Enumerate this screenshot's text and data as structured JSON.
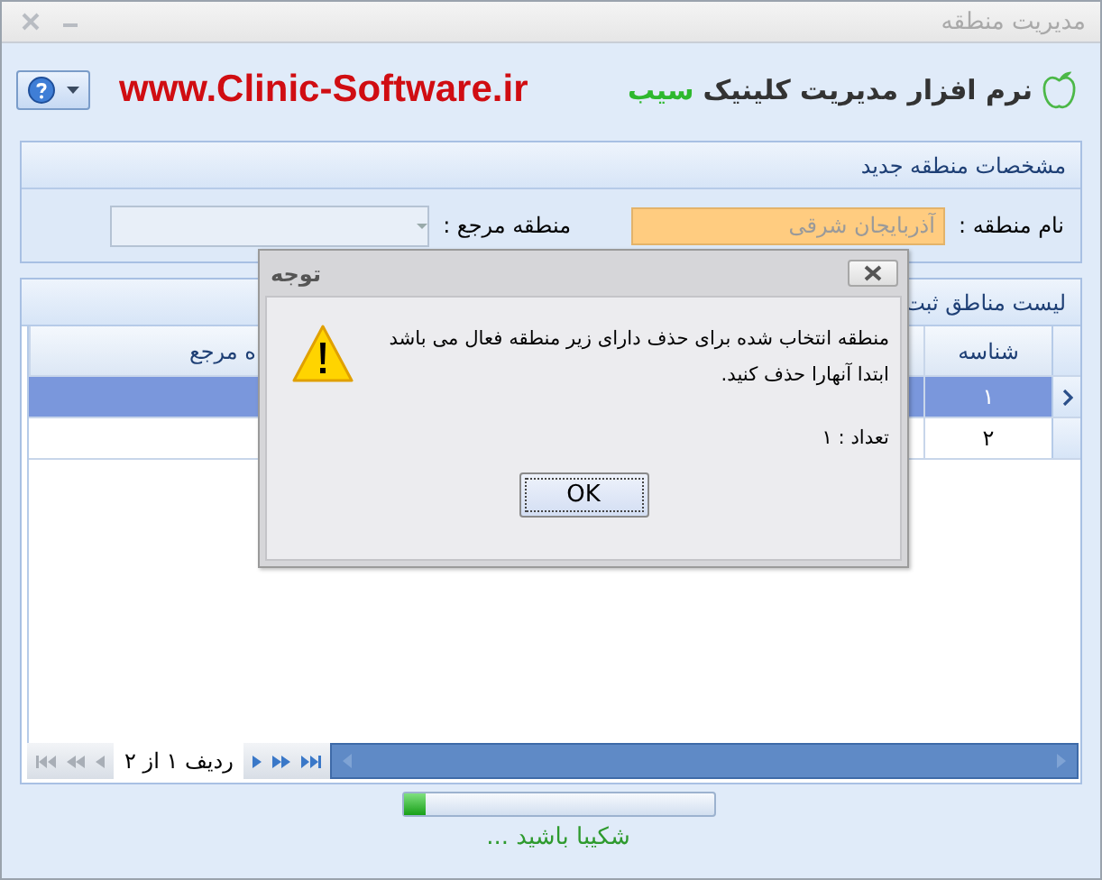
{
  "window": {
    "title": "مدیریت منطقه"
  },
  "header": {
    "logo_text": "نرم افزار مدیریت کلینیک",
    "logo_brand": "سیب",
    "url": "www.Clinic-Software.ir"
  },
  "new_region": {
    "title": "مشخصات منطقه جدید",
    "fields": [
      {
        "kind": "text",
        "label": "نام منطقه :",
        "placeholder": "آذربایجان شرقی"
      },
      {
        "kind": "combo",
        "label": "منطقه مرجع :"
      }
    ]
  },
  "region_list": {
    "title": "لیست مناطق ثبت",
    "columns": [
      "شناسه",
      "ه مرجع"
    ],
    "rows": [
      {
        "id": "۱",
        "selected": true
      },
      {
        "id": "۲",
        "selected": false
      }
    ],
    "navigator": "ردیف ۱ از ۲"
  },
  "progress": {
    "level": 0.07,
    "text": "شکیبا باشید ..."
  },
  "dialog": {
    "title": "توجه",
    "message_lines": [
      "منطقه انتخاب شده برای حذف دارای زیر منطقه فعال می باشد",
      "ابتدا آنهارا حذف کنید."
    ],
    "count": "تعداد : ۱",
    "button": "OK"
  }
}
